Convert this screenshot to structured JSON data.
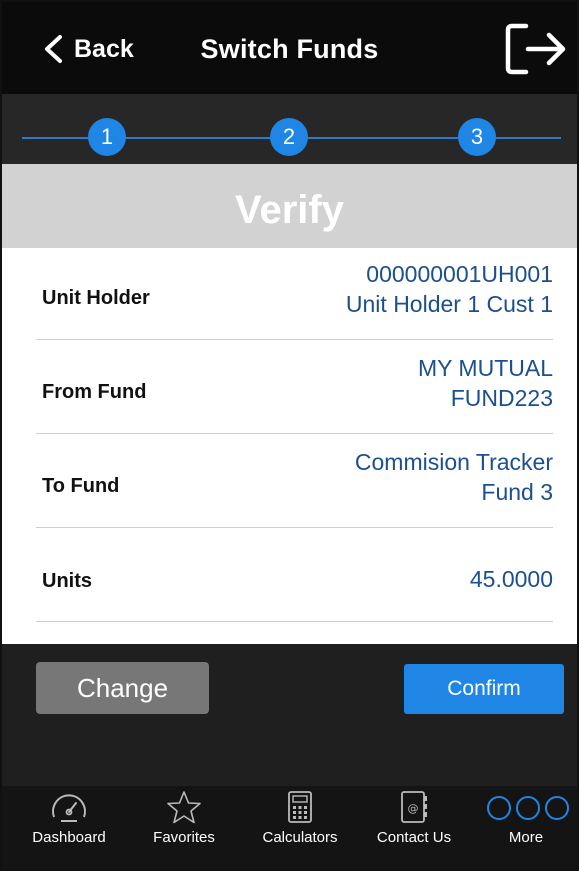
{
  "header": {
    "back_label": "Back",
    "title": "Switch Funds"
  },
  "steps": [
    "1",
    "2",
    "3"
  ],
  "banner": "Verify",
  "details": [
    {
      "label": "Unit Holder",
      "value_line1": "000000001UH001",
      "value_line2": "Unit Holder 1 Cust 1"
    },
    {
      "label": "From Fund",
      "value_line1": "MY MUTUAL",
      "value_line2": "FUND223"
    },
    {
      "label": "To Fund",
      "value_line1": "Commision Tracker",
      "value_line2": "Fund 3"
    },
    {
      "label": "Units",
      "value_line1": "45.0000",
      "value_line2": ""
    }
  ],
  "actions": {
    "change_label": "Change",
    "confirm_label": "Confirm"
  },
  "tabs": [
    {
      "label": "Dashboard",
      "icon": "dashboard-gauge-icon"
    },
    {
      "label": "Favorites",
      "icon": "star-icon"
    },
    {
      "label": "Calculators",
      "icon": "calculator-icon"
    },
    {
      "label": "Contact Us",
      "icon": "contact-book-icon"
    },
    {
      "label": "More",
      "icon": "more-circles-icon"
    }
  ],
  "colors": {
    "accent": "#1f86e6",
    "value_text": "#1c4f8f",
    "header_bg": "#0b0b0b",
    "banner_bg": "#d2d2d2"
  }
}
